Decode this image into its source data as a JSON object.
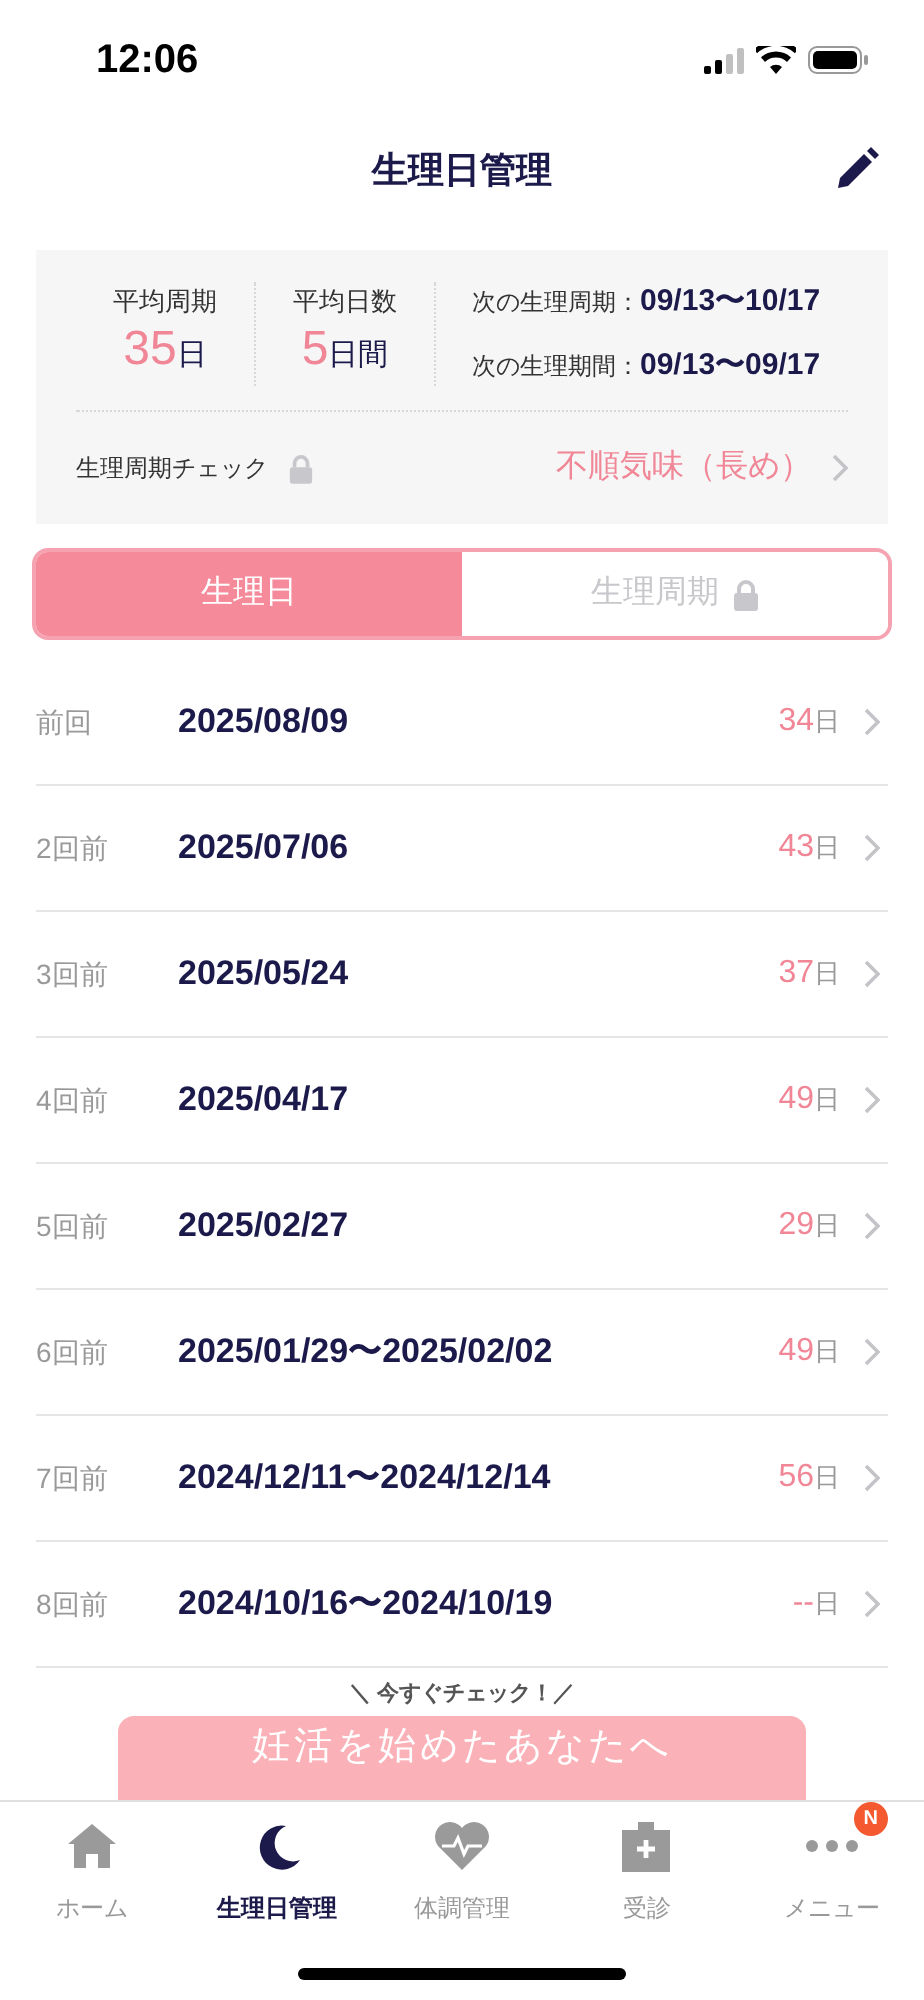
{
  "status_bar": {
    "time": "12:06"
  },
  "header": {
    "title": "生理日管理"
  },
  "summary": {
    "avg_cycle": {
      "label": "平均周期",
      "value": "35",
      "unit": "日"
    },
    "avg_days": {
      "label": "平均日数",
      "value": "5",
      "unit": "日間"
    },
    "next": [
      {
        "label": "次の生理周期：",
        "value": "09/13〜10/17"
      },
      {
        "label": "次の生理期間：",
        "value": "09/13〜09/17"
      }
    ],
    "check": {
      "label": "生理周期チェック",
      "locked": true,
      "result": "不順気味（長め）"
    }
  },
  "tabs": [
    {
      "label": "生理日",
      "selected": true,
      "locked": false
    },
    {
      "label": "生理周期",
      "selected": false,
      "locked": true
    }
  ],
  "rows": [
    {
      "label": "前回",
      "date": "2025/08/09",
      "days": "34",
      "unit": "日"
    },
    {
      "label": "2回前",
      "date": "2025/07/06",
      "days": "43",
      "unit": "日"
    },
    {
      "label": "3回前",
      "date": "2025/05/24",
      "days": "37",
      "unit": "日"
    },
    {
      "label": "4回前",
      "date": "2025/04/17",
      "days": "49",
      "unit": "日"
    },
    {
      "label": "5回前",
      "date": "2025/02/27",
      "days": "29",
      "unit": "日"
    },
    {
      "label": "6回前",
      "date": "2025/01/29〜2025/02/02",
      "days": "49",
      "unit": "日"
    },
    {
      "label": "7回前",
      "date": "2024/12/11〜2024/12/14",
      "days": "56",
      "unit": "日"
    },
    {
      "label": "8回前",
      "date": "2024/10/16〜2024/10/19",
      "days": "--",
      "unit": "日"
    }
  ],
  "banner": {
    "caption": "＼ 今すぐチェック！／",
    "button": "妊活を始めたあなたへ"
  },
  "tab_bar": [
    {
      "kind": "home",
      "label": "ホーム",
      "selected": false
    },
    {
      "kind": "moon",
      "label": "生理日管理",
      "selected": true
    },
    {
      "kind": "heart",
      "label": "体調管理",
      "selected": false
    },
    {
      "kind": "clinic",
      "label": "受診",
      "selected": false
    },
    {
      "kind": "more",
      "label": "メニュー",
      "selected": false,
      "badge": "N"
    }
  ]
}
